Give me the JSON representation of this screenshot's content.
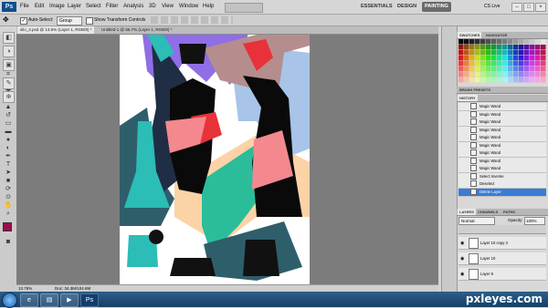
{
  "app": {
    "logo": "Ps",
    "menu": [
      "File",
      "Edit",
      "Image",
      "Layer",
      "Select",
      "Filter",
      "Analysis",
      "3D",
      "View",
      "Window",
      "Help"
    ]
  },
  "workspace": {
    "buttons": [
      "ESSENTIALS",
      "DESIGN",
      "PAINTING"
    ],
    "active": "PAINTING",
    "cslive": "CS Live"
  },
  "options": {
    "auto_select_label": "Auto-Select:",
    "auto_select_value": "Group",
    "show_transform_label": "Show Transform Controls"
  },
  "tabs": [
    "silo_2.psd @ 13.6% (Layer 1, RGB/8) *",
    "Untitled-1 @ 66.7% (Layer 1, RGB/8) *"
  ],
  "status": {
    "zoom": "13.76%",
    "doc": "Doc: 34.3M/104.6M"
  },
  "panels": {
    "swatches_tabs": [
      "SWATCHES",
      "NAVIGATOR"
    ],
    "brush_presets": "BRUSH PRESETS",
    "history_title": "HISTORY",
    "history": [
      "Magic Wand",
      "Magic Wand",
      "Magic Wand",
      "Magic Wand",
      "Magic Wand",
      "Magic Wand",
      "Magic Wand",
      "Magic Wand",
      "Magic Wand",
      "Select Inverse",
      "Deselect",
      "Delete Layer"
    ],
    "layers_tabs": [
      "LAYERS",
      "CHANNELS",
      "PATHS"
    ],
    "blend_mode": "Normal",
    "opacity_label": "Opacity:",
    "opacity_value": "100%",
    "layers": [
      "Layer 10 copy 3",
      "Layer 10",
      "Layer 6"
    ]
  },
  "watermark": "pxleyes.com",
  "colors": {
    "accent": "#3a7bd5",
    "teal": "#2bbdb6",
    "pink": "#f4888f",
    "red": "#e8323a",
    "peach": "#fbd3a6",
    "slate": "#2f5e6b",
    "sky": "#a8c4e8"
  }
}
